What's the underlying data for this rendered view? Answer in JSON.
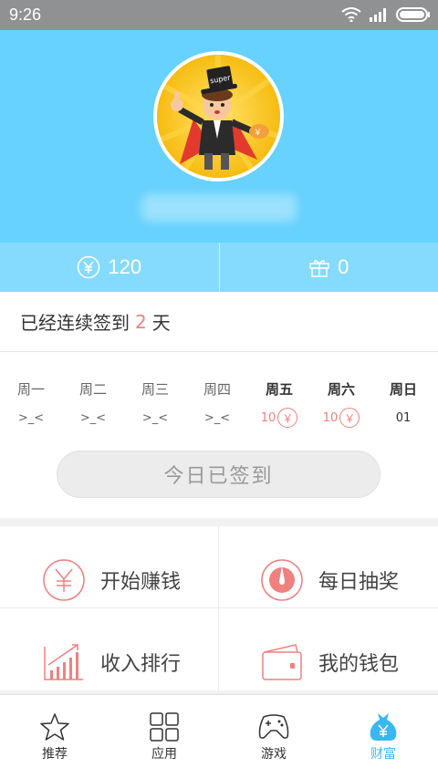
{
  "status_bar": {
    "time": "9:26"
  },
  "stats": {
    "coins": "120",
    "gifts": "0"
  },
  "signin": {
    "prefix": "已经连续签到",
    "days": "2",
    "suffix": "天"
  },
  "week": [
    {
      "name": "周一",
      "value": ">_<",
      "active": false,
      "reward": false
    },
    {
      "name": "周二",
      "value": ">_<",
      "active": false,
      "reward": false
    },
    {
      "name": "周三",
      "value": ">_<",
      "active": false,
      "reward": false
    },
    {
      "name": "周四",
      "value": ">_<",
      "active": false,
      "reward": false
    },
    {
      "name": "周五",
      "value": "10",
      "active": true,
      "reward": true
    },
    {
      "name": "周六",
      "value": "10",
      "active": true,
      "reward": true
    },
    {
      "name": "周日",
      "value": "01",
      "active": true,
      "reward": false
    }
  ],
  "signed_button": "今日已签到",
  "features": {
    "earn": "开始赚钱",
    "lottery": "每日抽奖",
    "ranking": "收入排行",
    "wallet": "我的钱包"
  },
  "nav": {
    "recommend": "推荐",
    "apps": "应用",
    "games": "游戏",
    "wealth": "财富"
  },
  "avatar_text": "super",
  "yen_symbol": "￥",
  "colors": {
    "header": "#67d2fd",
    "stats_bar": "#85dbfd",
    "accent_red": "#f08080",
    "nav_active": "#38b8f2"
  }
}
